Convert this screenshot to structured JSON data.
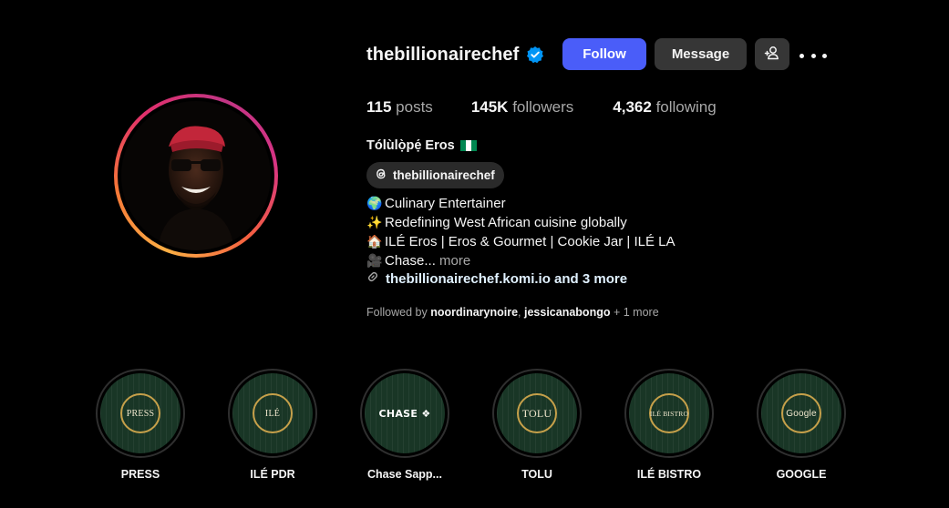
{
  "profile": {
    "username": "thebillionairechef",
    "verified": true,
    "full_name": "Tólùlọ̀pẹ́ Eros",
    "flag": "nigeria-flag",
    "threads_handle": "thebillionairechef",
    "stats": {
      "posts_count": "115",
      "posts_label": "posts",
      "followers_count": "145K",
      "followers_label": "followers",
      "following_count": "4,362",
      "following_label": "following"
    }
  },
  "buttons": {
    "follow": "Follow",
    "message": "Message"
  },
  "bio": {
    "line1": {
      "icon": "globe-icon",
      "text": "Culinary Entertainer"
    },
    "line2": {
      "icon": "sparkles-icon",
      "text": "Redefining West African cuisine globally"
    },
    "line3": {
      "icon": "house-icon",
      "text": "ILÉ Eros | Eros & Gourmet | Cookie Jar | ILÉ LA"
    },
    "line4": {
      "icon": "camera-icon",
      "text": "Chase...",
      "more": "more"
    },
    "link": "thebillionairechef.komi.io and 3 more"
  },
  "followed_by": {
    "prefix": "Followed by",
    "user1": "noordinarynoire",
    "separator": ",",
    "user2": "jessicanabongo",
    "suffix": "+ 1 more"
  },
  "highlights": [
    {
      "label": "PRESS",
      "cover": "PRESS"
    },
    {
      "label": "ILÉ PDR",
      "cover": "ILÉ"
    },
    {
      "label": "Chase Sapp...",
      "cover": "CHASE"
    },
    {
      "label": "TOLU",
      "cover": "TOLU"
    },
    {
      "label": "ILÉ BISTRO",
      "cover": "ILÉ BISTRO"
    },
    {
      "label": "GOOGLE",
      "cover": "Google"
    }
  ],
  "colors": {
    "accent": "#4a5df9",
    "verified": "#0095f6",
    "highlight_bg": "#193626",
    "highlight_ring": "#c6a04a"
  }
}
